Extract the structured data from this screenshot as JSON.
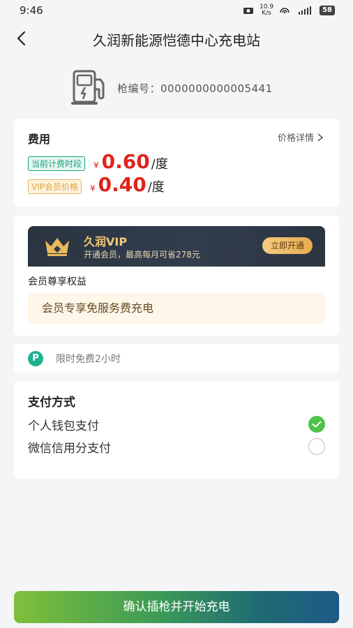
{
  "status_bar": {
    "time": "9:46",
    "net_speed_top": "10.9",
    "net_speed_bottom": "K/s",
    "battery": "58"
  },
  "header": {
    "title": "久润新能源恺德中心充电站"
  },
  "gun": {
    "label": "枪编号：0000000000005441"
  },
  "fee": {
    "title": "费用",
    "detail_link": "价格详情",
    "current_tag": "当前计费时段",
    "current_yen": "¥",
    "current_price": "0.60",
    "current_unit": "/度",
    "vip_tag": "VIP会员价格",
    "vip_yen": "¥",
    "vip_price": "0.40",
    "vip_unit": "/度"
  },
  "vip": {
    "title": "久润VIP",
    "subtitle": "开通会员，最高每月可省278元",
    "open_button": "立即开通",
    "benefits_title": "会员尊享权益",
    "benefit": "会员专享免服务费充电"
  },
  "parking": {
    "icon_letter": "P",
    "text": "限时免费2小时"
  },
  "payment": {
    "title": "支付方式",
    "options": [
      {
        "label": "个人钱包支付",
        "selected": true
      },
      {
        "label": "微信信用分支付",
        "selected": false
      }
    ]
  },
  "bottom_button": {
    "label": "确认插枪并开始充电"
  },
  "colors": {
    "price_red": "#e0231b",
    "accent_green": "#14a37f",
    "vip_gold": "#f2c779",
    "check_green": "#4fc24a"
  }
}
